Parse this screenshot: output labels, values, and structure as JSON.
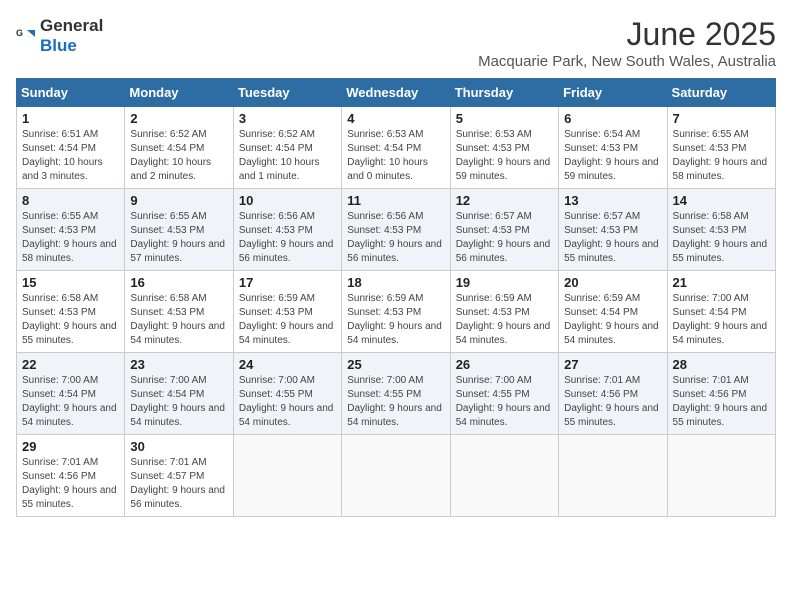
{
  "header": {
    "logo_general": "General",
    "logo_blue": "Blue",
    "month_title": "June 2025",
    "location": "Macquarie Park, New South Wales, Australia"
  },
  "weekdays": [
    "Sunday",
    "Monday",
    "Tuesday",
    "Wednesday",
    "Thursday",
    "Friday",
    "Saturday"
  ],
  "weeks": [
    [
      {
        "day": "1",
        "sunrise": "6:51 AM",
        "sunset": "4:54 PM",
        "daylight": "10 hours and 3 minutes."
      },
      {
        "day": "2",
        "sunrise": "6:52 AM",
        "sunset": "4:54 PM",
        "daylight": "10 hours and 2 minutes."
      },
      {
        "day": "3",
        "sunrise": "6:52 AM",
        "sunset": "4:54 PM",
        "daylight": "10 hours and 1 minute."
      },
      {
        "day": "4",
        "sunrise": "6:53 AM",
        "sunset": "4:54 PM",
        "daylight": "10 hours and 0 minutes."
      },
      {
        "day": "5",
        "sunrise": "6:53 AM",
        "sunset": "4:53 PM",
        "daylight": "9 hours and 59 minutes."
      },
      {
        "day": "6",
        "sunrise": "6:54 AM",
        "sunset": "4:53 PM",
        "daylight": "9 hours and 59 minutes."
      },
      {
        "day": "7",
        "sunrise": "6:55 AM",
        "sunset": "4:53 PM",
        "daylight": "9 hours and 58 minutes."
      }
    ],
    [
      {
        "day": "8",
        "sunrise": "6:55 AM",
        "sunset": "4:53 PM",
        "daylight": "9 hours and 58 minutes."
      },
      {
        "day": "9",
        "sunrise": "6:55 AM",
        "sunset": "4:53 PM",
        "daylight": "9 hours and 57 minutes."
      },
      {
        "day": "10",
        "sunrise": "6:56 AM",
        "sunset": "4:53 PM",
        "daylight": "9 hours and 56 minutes."
      },
      {
        "day": "11",
        "sunrise": "6:56 AM",
        "sunset": "4:53 PM",
        "daylight": "9 hours and 56 minutes."
      },
      {
        "day": "12",
        "sunrise": "6:57 AM",
        "sunset": "4:53 PM",
        "daylight": "9 hours and 56 minutes."
      },
      {
        "day": "13",
        "sunrise": "6:57 AM",
        "sunset": "4:53 PM",
        "daylight": "9 hours and 55 minutes."
      },
      {
        "day": "14",
        "sunrise": "6:58 AM",
        "sunset": "4:53 PM",
        "daylight": "9 hours and 55 minutes."
      }
    ],
    [
      {
        "day": "15",
        "sunrise": "6:58 AM",
        "sunset": "4:53 PM",
        "daylight": "9 hours and 55 minutes."
      },
      {
        "day": "16",
        "sunrise": "6:58 AM",
        "sunset": "4:53 PM",
        "daylight": "9 hours and 54 minutes."
      },
      {
        "day": "17",
        "sunrise": "6:59 AM",
        "sunset": "4:53 PM",
        "daylight": "9 hours and 54 minutes."
      },
      {
        "day": "18",
        "sunrise": "6:59 AM",
        "sunset": "4:53 PM",
        "daylight": "9 hours and 54 minutes."
      },
      {
        "day": "19",
        "sunrise": "6:59 AM",
        "sunset": "4:53 PM",
        "daylight": "9 hours and 54 minutes."
      },
      {
        "day": "20",
        "sunrise": "6:59 AM",
        "sunset": "4:54 PM",
        "daylight": "9 hours and 54 minutes."
      },
      {
        "day": "21",
        "sunrise": "7:00 AM",
        "sunset": "4:54 PM",
        "daylight": "9 hours and 54 minutes."
      }
    ],
    [
      {
        "day": "22",
        "sunrise": "7:00 AM",
        "sunset": "4:54 PM",
        "daylight": "9 hours and 54 minutes."
      },
      {
        "day": "23",
        "sunrise": "7:00 AM",
        "sunset": "4:54 PM",
        "daylight": "9 hours and 54 minutes."
      },
      {
        "day": "24",
        "sunrise": "7:00 AM",
        "sunset": "4:55 PM",
        "daylight": "9 hours and 54 minutes."
      },
      {
        "day": "25",
        "sunrise": "7:00 AM",
        "sunset": "4:55 PM",
        "daylight": "9 hours and 54 minutes."
      },
      {
        "day": "26",
        "sunrise": "7:00 AM",
        "sunset": "4:55 PM",
        "daylight": "9 hours and 54 minutes."
      },
      {
        "day": "27",
        "sunrise": "7:01 AM",
        "sunset": "4:56 PM",
        "daylight": "9 hours and 55 minutes."
      },
      {
        "day": "28",
        "sunrise": "7:01 AM",
        "sunset": "4:56 PM",
        "daylight": "9 hours and 55 minutes."
      }
    ],
    [
      {
        "day": "29",
        "sunrise": "7:01 AM",
        "sunset": "4:56 PM",
        "daylight": "9 hours and 55 minutes."
      },
      {
        "day": "30",
        "sunrise": "7:01 AM",
        "sunset": "4:57 PM",
        "daylight": "9 hours and 56 minutes."
      },
      null,
      null,
      null,
      null,
      null
    ]
  ],
  "labels": {
    "sunrise_prefix": "Sunrise: ",
    "sunset_prefix": "Sunset: ",
    "daylight_prefix": "Daylight: "
  }
}
